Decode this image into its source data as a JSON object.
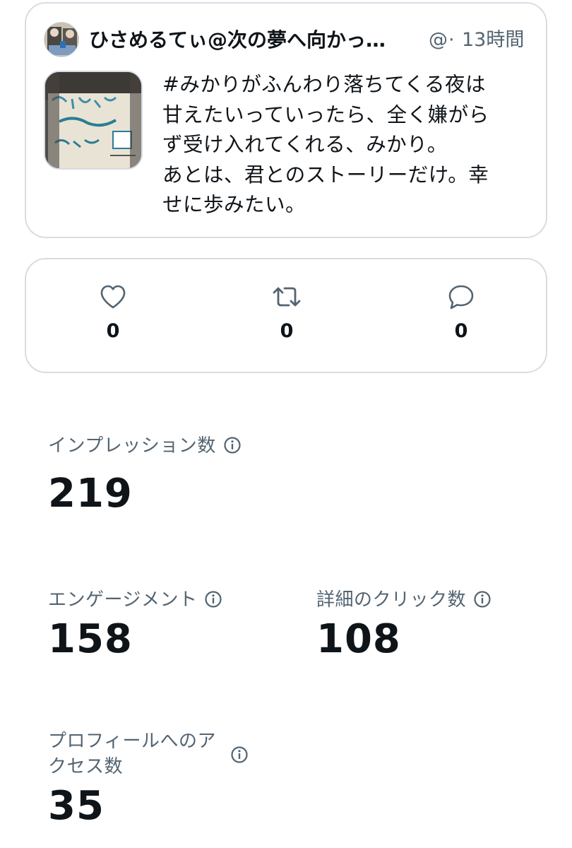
{
  "tweet": {
    "display_name": "ひさめるてぃ@次の夢へ向かっ…",
    "handle": "@",
    "separator": "·",
    "timestamp": "13時間",
    "text": "#みかりがふんわり落ちてくる夜は\n甘えたいっていったら、全く嫌がら\nず受け入れてくれる、みかり。\nあとは、君とのストーリーだけ。幸\nせに歩みたい。"
  },
  "engagement": {
    "likes": "0",
    "retweets": "0",
    "replies": "0"
  },
  "metrics": {
    "impressions": {
      "label": "インプレッション数",
      "value": "219"
    },
    "engagements": {
      "label": "エンゲージメント",
      "value": "158"
    },
    "detail_clicks": {
      "label": "詳細のクリック数",
      "value": "108"
    },
    "profile_visits": {
      "label": "プロフィールへのア\nクセス数",
      "value": "35"
    }
  },
  "colors": {
    "text_primary": "#0f1419",
    "text_secondary": "#536471",
    "border": "#d6dde3"
  },
  "icons": {
    "like": "heart-icon",
    "retweet": "retweet-icon",
    "reply": "reply-icon",
    "info": "info-icon"
  }
}
